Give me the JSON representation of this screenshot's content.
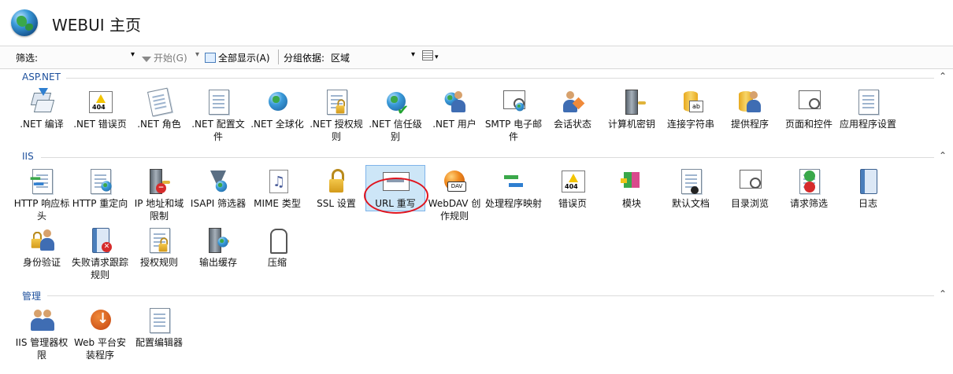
{
  "header": {
    "title": "WEBUI 主页"
  },
  "toolbar": {
    "filter_label": "筛选:",
    "start_label": "开始(G)",
    "show_all_label": "全部显示(A)",
    "group_label": "分组依据:",
    "group_value": "区域"
  },
  "sections": [
    {
      "title": "ASP.NET",
      "items": [
        {
          "label": ".NET 编译",
          "icon": "download-stack-icon"
        },
        {
          "label": ".NET 错误页",
          "icon": "error-404-icon"
        },
        {
          "label": ".NET 角色",
          "icon": "roles-icon"
        },
        {
          "label": ".NET 配置文件",
          "icon": "profile-doc-icon"
        },
        {
          "label": ".NET 全球化",
          "icon": "globe-icon"
        },
        {
          "label": ".NET 授权规则",
          "icon": "auth-lock-icon"
        },
        {
          "label": ".NET 信任级别",
          "icon": "trust-check-icon"
        },
        {
          "label": ".NET 用户",
          "icon": "users-icon"
        },
        {
          "label": "SMTP 电子邮件",
          "icon": "email-icon"
        },
        {
          "label": "会话状态",
          "icon": "session-icon"
        },
        {
          "label": "计算机密钥",
          "icon": "machine-key-icon"
        },
        {
          "label": "连接字符串",
          "icon": "connection-string-icon"
        },
        {
          "label": "提供程序",
          "icon": "providers-icon"
        },
        {
          "label": "页面和控件",
          "icon": "pages-controls-icon"
        },
        {
          "label": "应用程序设置",
          "icon": "app-settings-icon"
        }
      ]
    },
    {
      "title": "IIS",
      "items": [
        {
          "label": "HTTP 响应标头",
          "icon": "http-headers-icon"
        },
        {
          "label": "HTTP 重定向",
          "icon": "http-redirect-icon"
        },
        {
          "label": "IP 地址和域限制",
          "icon": "ip-restrict-icon"
        },
        {
          "label": "ISAPI 筛选器",
          "icon": "isapi-filter-icon"
        },
        {
          "label": "MIME 类型",
          "icon": "mime-type-icon"
        },
        {
          "label": "SSL 设置",
          "icon": "ssl-lock-icon"
        },
        {
          "label": "URL 重写",
          "icon": "url-rewrite-icon"
        },
        {
          "label": "WebDAV 创作规则",
          "icon": "webdav-icon"
        },
        {
          "label": "处理程序映射",
          "icon": "handler-mapping-icon"
        },
        {
          "label": "错误页",
          "icon": "error-page-icon"
        },
        {
          "label": "模块",
          "icon": "modules-icon"
        },
        {
          "label": "默认文档",
          "icon": "default-doc-icon"
        },
        {
          "label": "目录浏览",
          "icon": "dir-browse-icon"
        },
        {
          "label": "请求筛选",
          "icon": "request-filter-icon"
        },
        {
          "label": "日志",
          "icon": "logging-icon"
        },
        {
          "label": "身份验证",
          "icon": "authentication-icon"
        },
        {
          "label": "失败请求跟踪规则",
          "icon": "failed-request-icon"
        },
        {
          "label": "授权规则",
          "icon": "authorization-icon"
        },
        {
          "label": "输出缓存",
          "icon": "output-cache-icon"
        },
        {
          "label": "压缩",
          "icon": "compression-icon"
        }
      ]
    },
    {
      "title": "管理",
      "items": [
        {
          "label": "IIS 管理器权限",
          "icon": "mgr-permissions-icon"
        },
        {
          "label": "Web 平台安装程序",
          "icon": "web-platform-icon"
        },
        {
          "label": "配置编辑器",
          "icon": "config-editor-icon"
        }
      ]
    }
  ],
  "selected_item": "URL 重写"
}
